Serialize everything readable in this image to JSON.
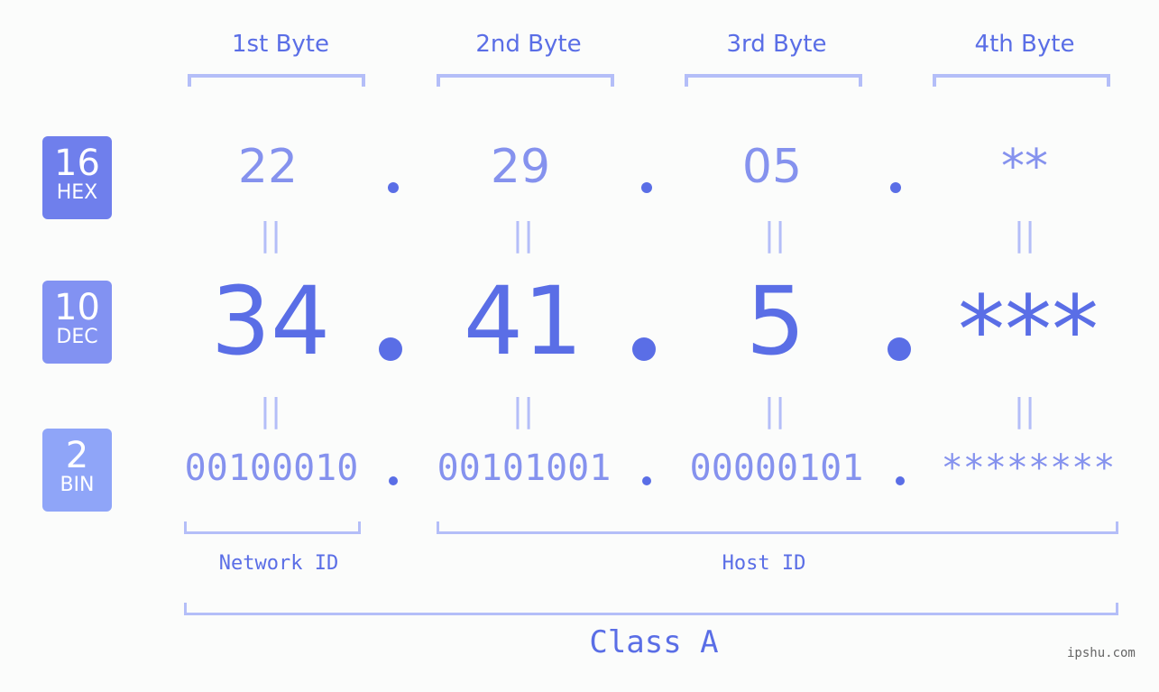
{
  "colors": {
    "accent": "#5a6ee6",
    "light_accent": "#8592ee",
    "bracket": "#b4bef8",
    "badge_hex": "#6f7fec",
    "badge_dec": "#8292f2",
    "badge_bin": "#8fa5f8",
    "background": "#fbfcfb"
  },
  "byte_headers": [
    "1st Byte",
    "2nd Byte",
    "3rd Byte",
    "4th Byte"
  ],
  "badges": [
    {
      "base": "16",
      "label": "HEX"
    },
    {
      "base": "10",
      "label": "DEC"
    },
    {
      "base": "2",
      "label": "BIN"
    }
  ],
  "hex_values": [
    "22",
    "29",
    "05",
    "**"
  ],
  "dec_values": [
    "34",
    "41",
    "5",
    "***"
  ],
  "bin_values": [
    "00100010",
    "00101001",
    "00000101",
    "********"
  ],
  "equals_sign": "||",
  "network_id_label": "Network ID",
  "host_id_label": "Host ID",
  "class_label": "Class A",
  "watermark": "ipshu.com"
}
